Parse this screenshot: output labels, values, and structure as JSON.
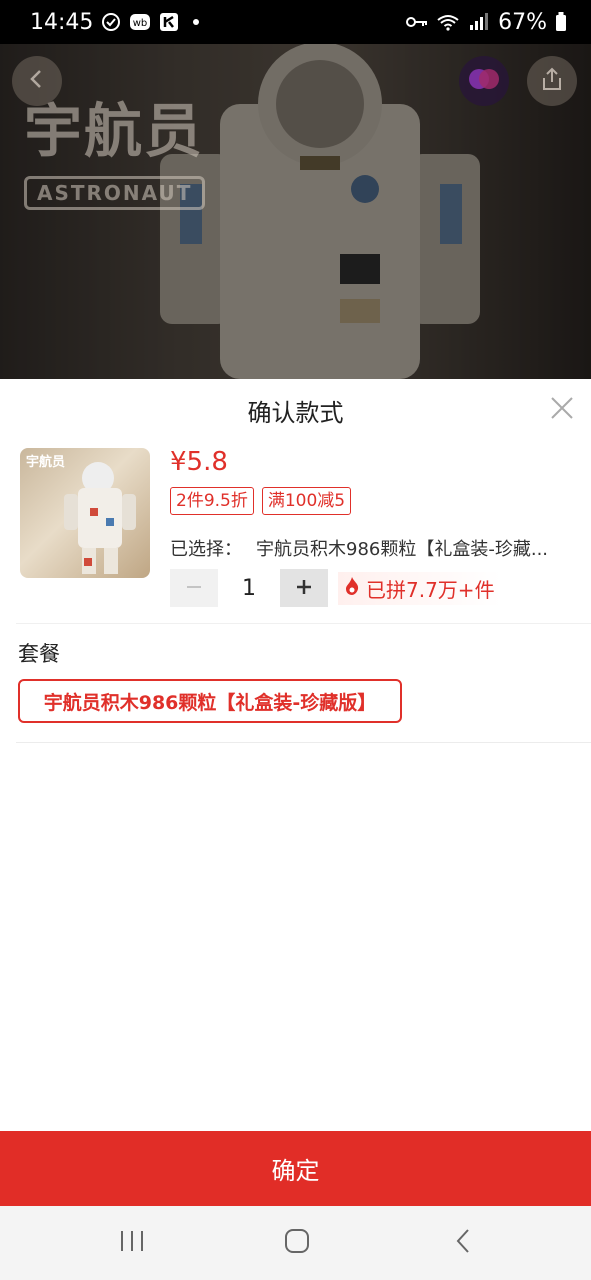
{
  "status_bar": {
    "time": "14:45",
    "battery": "67%",
    "icons": [
      "check-circle-icon",
      "weibo-icon",
      "app-icon",
      "key-icon",
      "wifi-icon",
      "signal-icon",
      "battery-icon"
    ]
  },
  "hero": {
    "logo_cn": "宇航员",
    "logo_en": "ASTRONAUT"
  },
  "sheet": {
    "title": "确认款式",
    "price": "¥5.8",
    "tags": [
      "2件9.5折",
      "满100减5"
    ],
    "selected_label": "已选择：",
    "selected_value": "宇航员积木986颗粒【礼盒装-珍藏...",
    "quantity": "1",
    "sold": "已拼7.7万+件",
    "section_label": "套餐",
    "option": "宇航员积木986颗粒【礼盒装-珍藏版】",
    "thumb_logo": "宇航员"
  },
  "confirm_label": "确定",
  "colors": {
    "accent": "#e12d27",
    "price": "#e0302a"
  }
}
